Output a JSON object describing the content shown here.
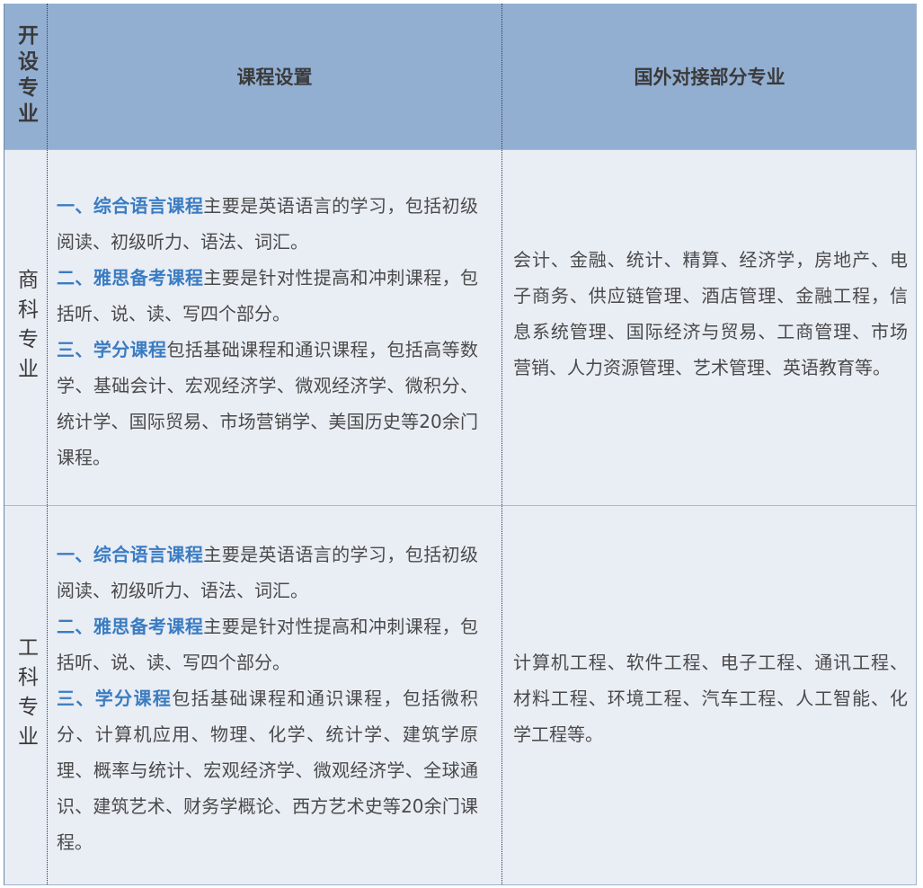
{
  "header": {
    "col1": "开设专业",
    "col2": "课程设置",
    "col3": "国外对接部分专业"
  },
  "rows": [
    {
      "label": "商科专业",
      "courses": [
        {
          "title": "一、综合语言课程",
          "desc": "主要是英语语言的学习，包括初级阅读、初级听力、语法、词汇。"
        },
        {
          "title": "二、雅思备考课程",
          "desc": "主要是针对性提高和冲刺课程，包括听、说、读、写四个部分。"
        },
        {
          "title": "三、学分课程",
          "desc": "包括基础课程和通识课程，包括高等数学、基础会计、宏观经济学、微观经济学、微积分、统计学、国际贸易、市场营销学、美国历史等20余门课程。"
        }
      ],
      "majors": "会计、金融、统计、精算、经济学，房地产、电子商务、供应链管理、酒店管理、金融工程，信息系统管理、国际经济与贸易、工商管理、市场营销、人力资源管理、艺术管理、英语教育等。"
    },
    {
      "label": "工科专业",
      "courses": [
        {
          "title": "一、综合语言课程",
          "desc": "主要是英语语言的学习，包括初级阅读、初级听力、语法、词汇。"
        },
        {
          "title": "二、雅思备考课程",
          "desc": "主要是针对性提高和冲刺课程，包括听、说、读、写四个部分。"
        },
        {
          "title": "三、学分课程",
          "desc": "包括基础课程和通识课程，包括微积分、计算机应用、物理、化学、统计学、建筑学原理、概率与统计、宏观经济学、微观经济学、全球通识、建筑艺术、财务学概论、西方艺术史等20余门课程。"
        }
      ],
      "majors": "计算机工程、软件工程、电子工程、通讯工程、材料工程、环境工程、汽车工程、人工智能、化学工程等。"
    }
  ],
  "colors": {
    "header_bg": "#92afd2",
    "body_bg": "#e9edf4",
    "keyword": "#3a7cc2"
  }
}
